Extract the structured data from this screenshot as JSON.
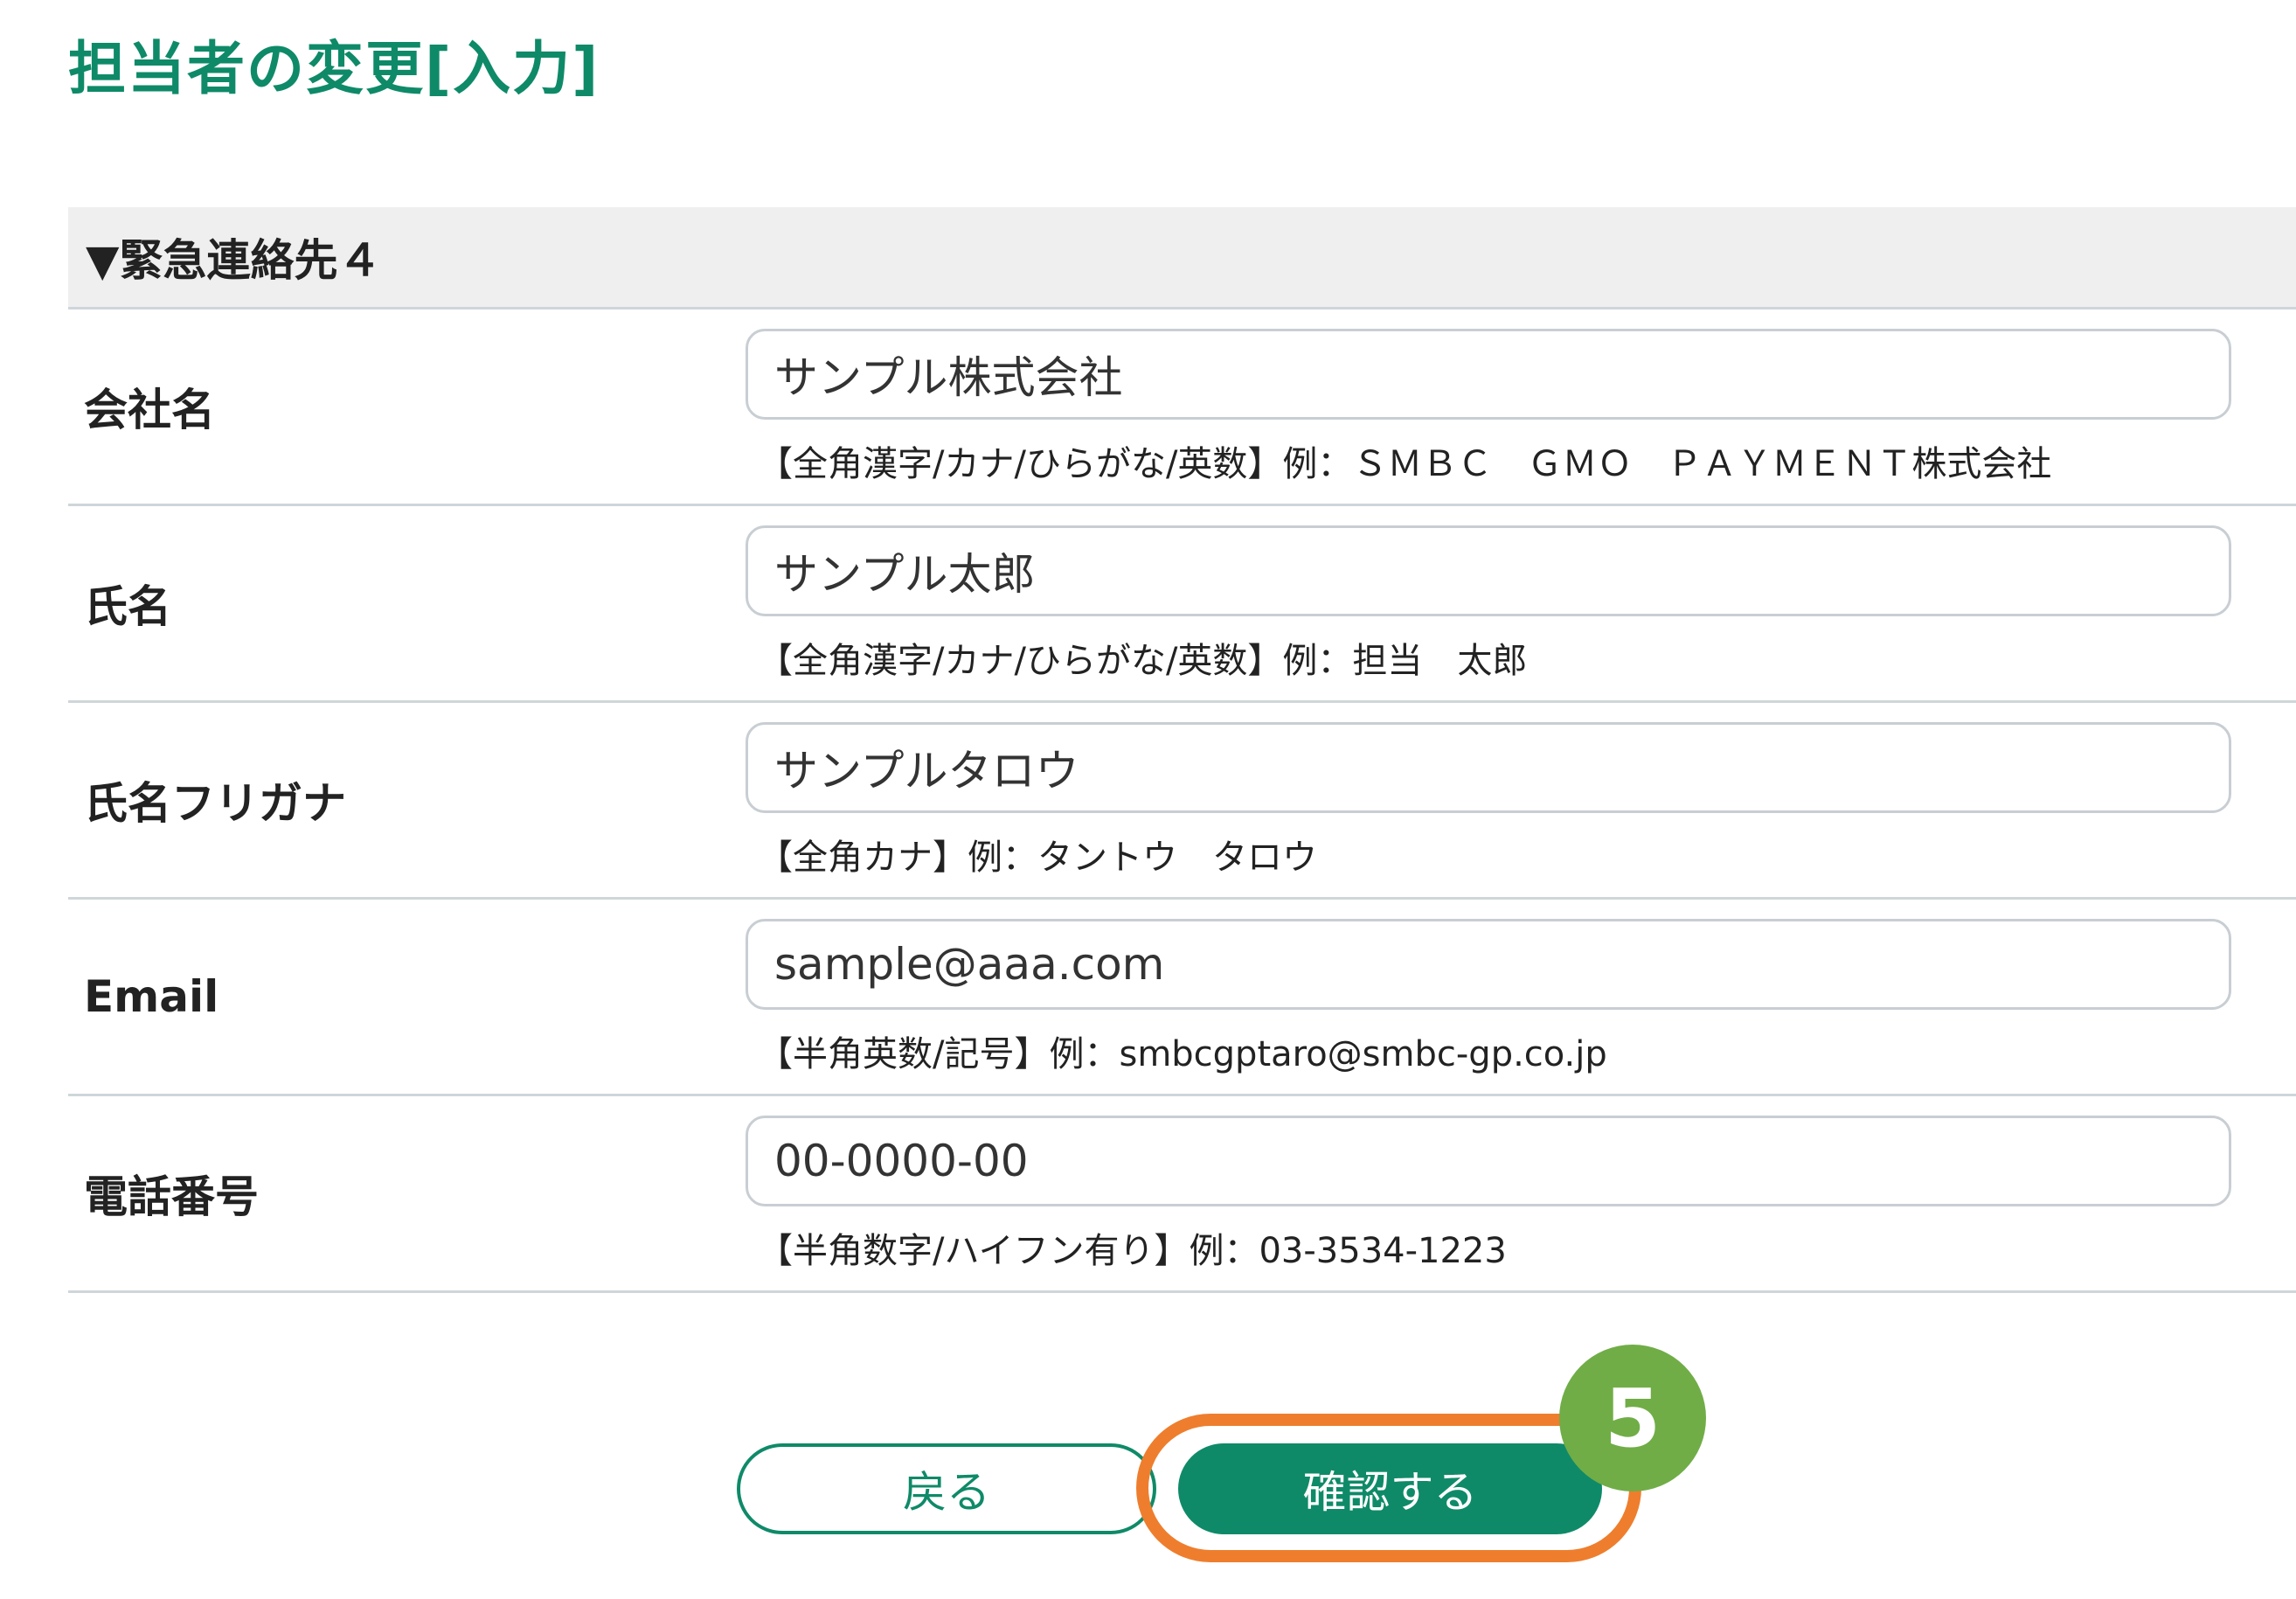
{
  "page": {
    "title": "担当者の変更[入力]"
  },
  "section": {
    "header": "▼緊急連絡先４"
  },
  "fields": [
    {
      "label": "会社名",
      "value": "サンプル株式会社",
      "hint": "【全角漢字/カナ/ひらがな/英数】例：ＳＭＢＣ　ＧＭＯ　ＰＡＹＭＥＮＴ株式会社"
    },
    {
      "label": "氏名",
      "value": "サンプル太郎",
      "hint": "【全角漢字/カナ/ひらがな/英数】例：担当　太郎"
    },
    {
      "label": "氏名フリガナ",
      "value": "サンプルタロウ",
      "hint": "【全角カナ】例：タントウ　タロウ"
    },
    {
      "label": "Email",
      "value": "sample@aaa.com",
      "hint": "【半角英数/記号】例：smbcgptaro@smbc-gp.co.jp"
    },
    {
      "label": "電話番号",
      "value": "00-0000-00",
      "hint": "【半角数字/ハイフン有り】例：03-3534-1223"
    }
  ],
  "buttons": {
    "back_label": "戻る",
    "confirm_label": "確認する"
  },
  "annotation": {
    "step_number": "5",
    "ring_color": "#ee7e2d",
    "badge_color": "#70ad47"
  },
  "colors": {
    "brand_green": "#0f8a68",
    "section_bg": "#efefef",
    "border": "#cfd6da"
  }
}
